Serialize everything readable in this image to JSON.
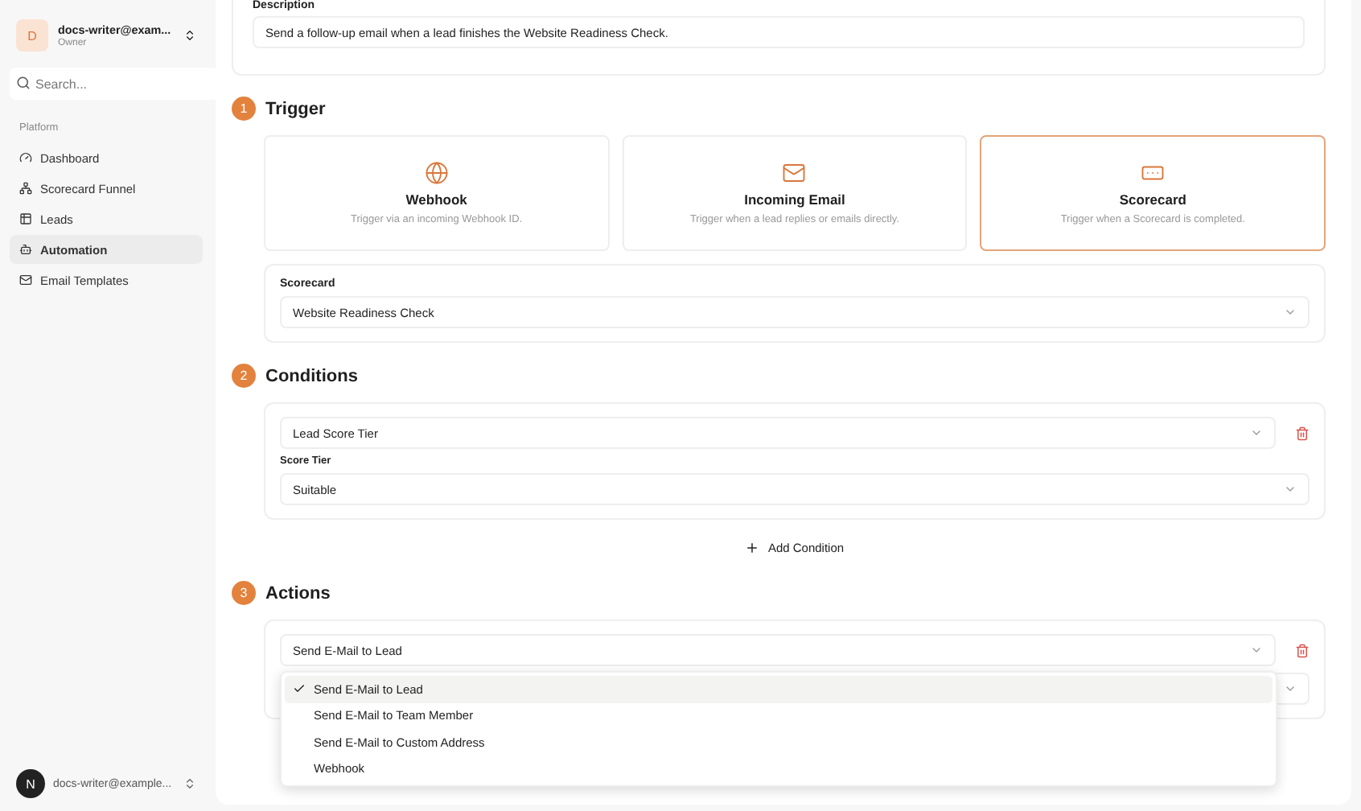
{
  "sidebar": {
    "account": {
      "avatar": "D",
      "name": "docs-writer@exam...",
      "role": "Owner"
    },
    "search": {
      "placeholder": "Search..."
    },
    "group_label": "Platform",
    "items": [
      {
        "label": "Dashboard",
        "selected": false
      },
      {
        "label": "Scorecard Funnel",
        "selected": false
      },
      {
        "label": "Leads",
        "selected": false
      },
      {
        "label": "Automation",
        "selected": true
      },
      {
        "label": "Email Templates",
        "selected": false
      }
    ],
    "footer": {
      "avatar": "N",
      "name": "docs-writer@example..."
    }
  },
  "description": {
    "label": "Description",
    "value": "Send a follow-up email when a lead finishes the Website Readiness Check."
  },
  "trigger": {
    "number": "1",
    "title": "Trigger",
    "options": [
      {
        "title": "Webhook",
        "subtitle": "Trigger via an incoming Webhook ID.",
        "selected": false
      },
      {
        "title": "Incoming Email",
        "subtitle": "Trigger when a lead replies or emails directly.",
        "selected": false
      },
      {
        "title": "Scorecard",
        "subtitle": "Trigger when a Scorecard is completed.",
        "selected": true
      }
    ],
    "scorecard": {
      "label": "Scorecard",
      "value": "Website Readiness Check"
    }
  },
  "conditions": {
    "number": "2",
    "title": "Conditions",
    "type_value": "Lead Score Tier",
    "tier_label": "Score Tier",
    "tier_value": "Suitable",
    "add_label": "Add Condition"
  },
  "actions": {
    "number": "3",
    "title": "Actions",
    "type_value": "Send E-Mail to Lead",
    "menu": [
      {
        "label": "Send E-Mail to Lead",
        "selected": true
      },
      {
        "label": "Send E-Mail to Team Member",
        "selected": false
      },
      {
        "label": "Send E-Mail to Custom Address",
        "selected": false
      },
      {
        "label": "Webhook",
        "selected": false
      }
    ]
  }
}
